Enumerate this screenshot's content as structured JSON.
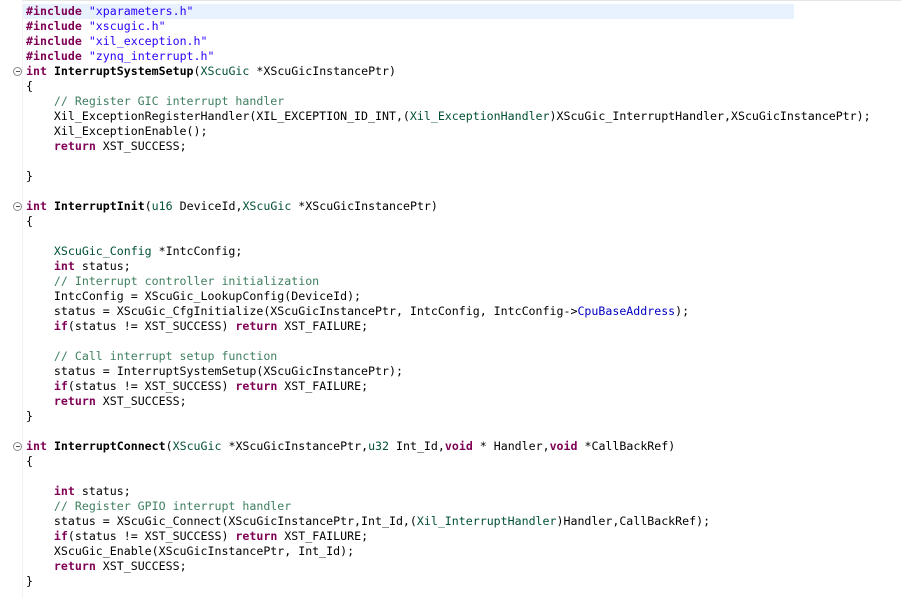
{
  "editor": {
    "lines": [
      {
        "id": "line-include-xparameters",
        "tokens": [
          {
            "c": "kw",
            "t": "#include"
          },
          {
            "c": "",
            "t": " "
          },
          {
            "c": "str",
            "t": "\"xparameters.h\""
          }
        ]
      },
      {
        "id": "line-include-xscugic",
        "tokens": [
          {
            "c": "kw",
            "t": "#include"
          },
          {
            "c": "",
            "t": " "
          },
          {
            "c": "str",
            "t": "\"xscugic.h\""
          }
        ]
      },
      {
        "id": "line-include-xil-exception",
        "tokens": [
          {
            "c": "kw",
            "t": "#include"
          },
          {
            "c": "",
            "t": " "
          },
          {
            "c": "str",
            "t": "\"xil_exception.h\""
          }
        ]
      },
      {
        "id": "line-include-zynq-interrupt",
        "tokens": [
          {
            "c": "kw",
            "t": "#include"
          },
          {
            "c": "",
            "t": " "
          },
          {
            "c": "str",
            "t": "\"zynq_interrupt.h\""
          }
        ]
      },
      {
        "id": "line-interrupt-system-setup-signature",
        "fold": true,
        "tokens": [
          {
            "c": "kw",
            "t": "int"
          },
          {
            "c": "",
            "t": " "
          },
          {
            "c": "fn",
            "t": "InterruptSystemSetup"
          },
          {
            "c": "",
            "t": "("
          },
          {
            "c": "ty",
            "t": "XScuGic"
          },
          {
            "c": "",
            "t": " *XScuGicInstancePtr)"
          }
        ]
      },
      {
        "id": "line-open-brace-1",
        "tokens": [
          {
            "c": "",
            "t": "{"
          }
        ]
      },
      {
        "id": "line-comment-register-gic",
        "tokens": [
          {
            "c": "",
            "t": "    "
          },
          {
            "c": "cm",
            "t": "// Register GIC interrupt handler"
          }
        ]
      },
      {
        "id": "line-exception-register-handler",
        "tokens": [
          {
            "c": "",
            "t": "    Xil_ExceptionRegisterHandler(XIL_EXCEPTION_ID_INT,("
          },
          {
            "c": "ty",
            "t": "Xil_ExceptionHandler"
          },
          {
            "c": "",
            "t": ")XScuGic_InterruptHandler,XScuGicInstancePtr);"
          }
        ]
      },
      {
        "id": "line-exception-enable",
        "tokens": [
          {
            "c": "",
            "t": "    Xil_ExceptionEnable();"
          }
        ]
      },
      {
        "id": "line-return-success-1",
        "tokens": [
          {
            "c": "",
            "t": "    "
          },
          {
            "c": "kw",
            "t": "return"
          },
          {
            "c": "",
            "t": " XST_SUCCESS;"
          }
        ]
      },
      {
        "id": "line-blank-1",
        "tokens": []
      },
      {
        "id": "line-close-brace-1",
        "tokens": [
          {
            "c": "",
            "t": "}"
          }
        ]
      },
      {
        "id": "line-blank-2",
        "tokens": []
      },
      {
        "id": "line-interrupt-init-signature",
        "fold": true,
        "tokens": [
          {
            "c": "kw",
            "t": "int"
          },
          {
            "c": "",
            "t": " "
          },
          {
            "c": "fn",
            "t": "InterruptInit"
          },
          {
            "c": "",
            "t": "("
          },
          {
            "c": "ty",
            "t": "u16"
          },
          {
            "c": "",
            "t": " DeviceId,"
          },
          {
            "c": "ty",
            "t": "XScuGic"
          },
          {
            "c": "",
            "t": " *XScuGicInstancePtr)"
          }
        ]
      },
      {
        "id": "line-open-brace-2",
        "tokens": [
          {
            "c": "",
            "t": "{"
          }
        ]
      },
      {
        "id": "line-blank-3",
        "tokens": []
      },
      {
        "id": "line-intc-config-decl",
        "tokens": [
          {
            "c": "",
            "t": "    "
          },
          {
            "c": "ty",
            "t": "XScuGic_Config"
          },
          {
            "c": "",
            "t": " *IntcConfig;"
          }
        ]
      },
      {
        "id": "line-status-decl-1",
        "tokens": [
          {
            "c": "",
            "t": "    "
          },
          {
            "c": "kw",
            "t": "int"
          },
          {
            "c": "",
            "t": " status;"
          }
        ]
      },
      {
        "id": "line-comment-controller-init",
        "tokens": [
          {
            "c": "",
            "t": "    "
          },
          {
            "c": "cm",
            "t": "// Interrupt controller initialization"
          }
        ]
      },
      {
        "id": "line-lookup-config",
        "tokens": [
          {
            "c": "",
            "t": "    IntcConfig = XScuGic_LookupConfig(DeviceId);"
          }
        ]
      },
      {
        "id": "line-cfg-initialize",
        "tokens": [
          {
            "c": "",
            "t": "    status = XScuGic_CfgInitialize(XScuGicInstancePtr, IntcConfig, IntcConfig->"
          },
          {
            "c": "fld",
            "t": "CpuBaseAddress"
          },
          {
            "c": "",
            "t": ");"
          }
        ]
      },
      {
        "id": "line-if-failure-1",
        "tokens": [
          {
            "c": "",
            "t": "    "
          },
          {
            "c": "kw",
            "t": "if"
          },
          {
            "c": "",
            "t": "(status != XST_SUCCESS) "
          },
          {
            "c": "kw",
            "t": "return"
          },
          {
            "c": "",
            "t": " XST_FAILURE;"
          }
        ]
      },
      {
        "id": "line-blank-4",
        "tokens": []
      },
      {
        "id": "line-comment-call-setup",
        "tokens": [
          {
            "c": "",
            "t": "    "
          },
          {
            "c": "cm",
            "t": "// Call interrupt setup function"
          }
        ]
      },
      {
        "id": "line-call-system-setup",
        "tokens": [
          {
            "c": "",
            "t": "    status = InterruptSystemSetup(XScuGicInstancePtr);"
          }
        ]
      },
      {
        "id": "line-if-failure-2",
        "tokens": [
          {
            "c": "",
            "t": "    "
          },
          {
            "c": "kw",
            "t": "if"
          },
          {
            "c": "",
            "t": "(status != XST_SUCCESS) "
          },
          {
            "c": "kw",
            "t": "return"
          },
          {
            "c": "",
            "t": " XST_FAILURE;"
          }
        ]
      },
      {
        "id": "line-return-success-2",
        "tokens": [
          {
            "c": "",
            "t": "    "
          },
          {
            "c": "kw",
            "t": "return"
          },
          {
            "c": "",
            "t": " XST_SUCCESS;"
          }
        ]
      },
      {
        "id": "line-close-brace-2",
        "tokens": [
          {
            "c": "",
            "t": "}"
          }
        ]
      },
      {
        "id": "line-blank-5",
        "tokens": []
      },
      {
        "id": "line-interrupt-connect-signature",
        "fold": true,
        "tokens": [
          {
            "c": "kw",
            "t": "int"
          },
          {
            "c": "",
            "t": " "
          },
          {
            "c": "fn",
            "t": "InterruptConnect"
          },
          {
            "c": "",
            "t": "("
          },
          {
            "c": "ty",
            "t": "XScuGic"
          },
          {
            "c": "",
            "t": " *XScuGicInstancePtr,"
          },
          {
            "c": "ty",
            "t": "u32"
          },
          {
            "c": "",
            "t": " Int_Id,"
          },
          {
            "c": "kw",
            "t": "void"
          },
          {
            "c": "",
            "t": " * Handler,"
          },
          {
            "c": "kw",
            "t": "void"
          },
          {
            "c": "",
            "t": " *CallBackRef)"
          }
        ]
      },
      {
        "id": "line-open-brace-3",
        "tokens": [
          {
            "c": "",
            "t": "{"
          }
        ]
      },
      {
        "id": "line-blank-6",
        "tokens": []
      },
      {
        "id": "line-status-decl-2",
        "tokens": [
          {
            "c": "",
            "t": "    "
          },
          {
            "c": "kw",
            "t": "int"
          },
          {
            "c": "",
            "t": " status;"
          }
        ]
      },
      {
        "id": "line-comment-register-gpio",
        "tokens": [
          {
            "c": "",
            "t": "    "
          },
          {
            "c": "cm",
            "t": "// Register GPIO interrupt handler"
          }
        ]
      },
      {
        "id": "line-scugic-connect",
        "tokens": [
          {
            "c": "",
            "t": "    status = XScuGic_Connect(XScuGicInstancePtr,Int_Id,("
          },
          {
            "c": "ty",
            "t": "Xil_InterruptHandler"
          },
          {
            "c": "",
            "t": ")Handler,CallBackRef);"
          }
        ]
      },
      {
        "id": "line-if-failure-3",
        "tokens": [
          {
            "c": "",
            "t": "    "
          },
          {
            "c": "kw",
            "t": "if"
          },
          {
            "c": "",
            "t": "(status != XST_SUCCESS) "
          },
          {
            "c": "kw",
            "t": "return"
          },
          {
            "c": "",
            "t": " XST_FAILURE;"
          }
        ]
      },
      {
        "id": "line-scugic-enable",
        "tokens": [
          {
            "c": "",
            "t": "    XScuGic_Enable(XScuGicInstancePtr, Int_Id);"
          }
        ]
      },
      {
        "id": "line-return-success-3",
        "tokens": [
          {
            "c": "",
            "t": "    "
          },
          {
            "c": "kw",
            "t": "return"
          },
          {
            "c": "",
            "t": " XST_SUCCESS;"
          }
        ]
      },
      {
        "id": "line-close-brace-3",
        "tokens": [
          {
            "c": "",
            "t": "}"
          }
        ]
      }
    ]
  }
}
